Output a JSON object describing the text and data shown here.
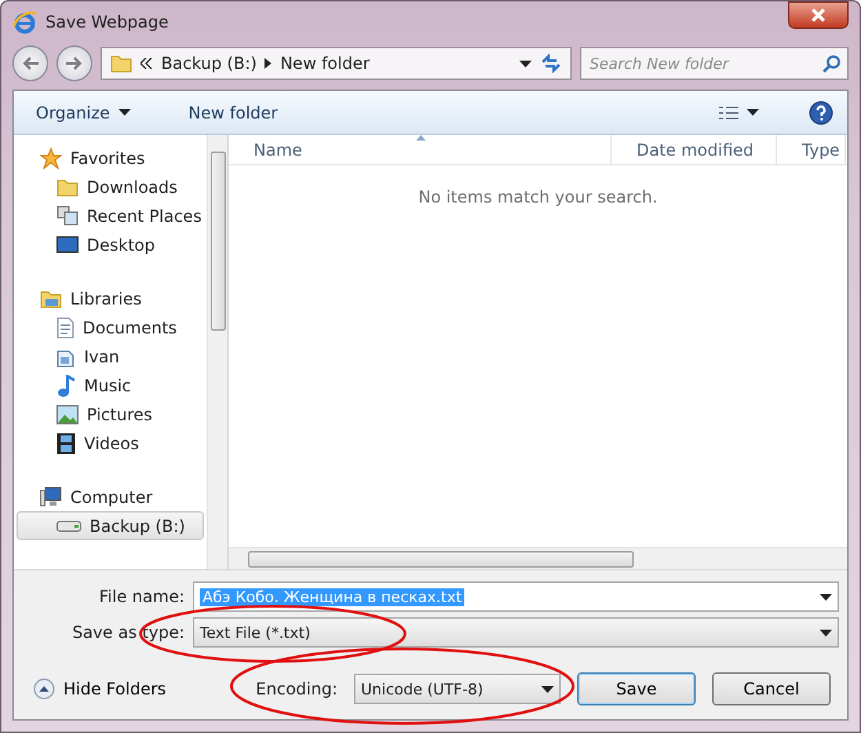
{
  "window": {
    "title": "Save Webpage"
  },
  "address": {
    "path": [
      "Backup (B:)",
      "New folder"
    ]
  },
  "search": {
    "placeholder": "Search New folder"
  },
  "toolbar": {
    "organize": "Organize",
    "new_folder": "New folder"
  },
  "sidebar": {
    "groups": [
      {
        "label": "Favorites",
        "selected": false,
        "children": [
          {
            "label": "Downloads",
            "selected": false
          },
          {
            "label": "Recent Places",
            "selected": false
          },
          {
            "label": "Desktop",
            "selected": false
          }
        ]
      },
      {
        "label": "Libraries",
        "selected": false,
        "children": [
          {
            "label": "Documents",
            "selected": false
          },
          {
            "label": "Ivan",
            "selected": false
          },
          {
            "label": "Music",
            "selected": false
          },
          {
            "label": "Pictures",
            "selected": false
          },
          {
            "label": "Videos",
            "selected": false
          }
        ]
      },
      {
        "label": "Computer",
        "selected": false,
        "children": [
          {
            "label": "Backup (B:)",
            "selected": true
          }
        ]
      }
    ]
  },
  "columns": [
    {
      "label": "Name",
      "sorted": true
    },
    {
      "label": "Date modified",
      "sorted": false
    },
    {
      "label": "Type",
      "sorted": false
    }
  ],
  "empty_message": "No items match your search.",
  "form": {
    "file_name": {
      "label": "File name:",
      "value": "Абэ Кобо. Женщина в песках.txt"
    },
    "save_as_type": {
      "label": "Save as type:",
      "value": "Text File (*.txt)"
    },
    "encoding": {
      "label": "Encoding:",
      "value": "Unicode (UTF-8)"
    }
  },
  "hide_folders": "Hide Folders",
  "buttons": [
    {
      "label": "Save",
      "default": true
    },
    {
      "label": "Cancel",
      "default": false
    }
  ]
}
